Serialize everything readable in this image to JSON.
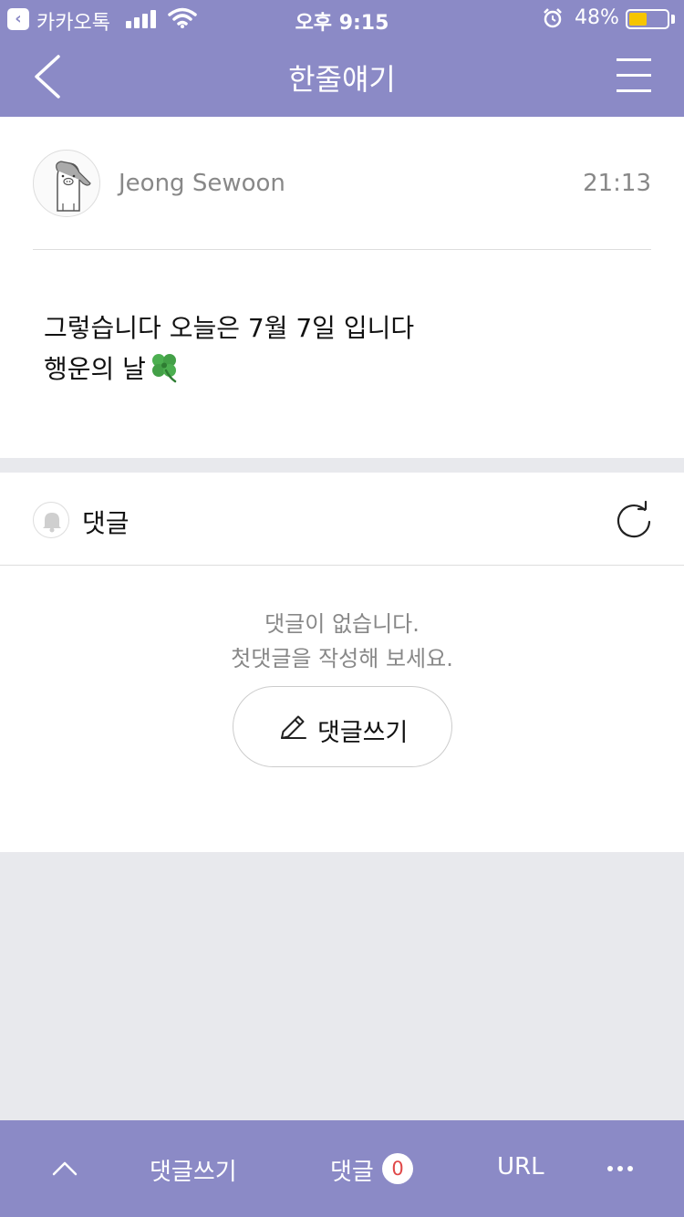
{
  "status_bar": {
    "app_name": "카카오톡",
    "time": "오후 9:15",
    "battery": "48%",
    "battery_level": 0.48
  },
  "nav": {
    "title": "한줄얘기"
  },
  "post": {
    "author": "Jeong Sewoon",
    "time": "21:13",
    "line1": "그렇습니다 오늘은 7월 7일 입니다",
    "line2": "행운의  날"
  },
  "comments": {
    "title": "댓글",
    "empty_line1": "댓글이 없습니다.",
    "empty_line2": "첫댓글을 작성해 보세요.",
    "write_button": "댓글쓰기"
  },
  "bottom_bar": {
    "write": "댓글쓰기",
    "comments": "댓글",
    "comment_count": "0",
    "url": "URL"
  },
  "colors": {
    "accent": "#8b8ac6",
    "battery_fill": "#f6c500",
    "count_badge_text": "#e04848",
    "background": "#e8e9ed"
  }
}
